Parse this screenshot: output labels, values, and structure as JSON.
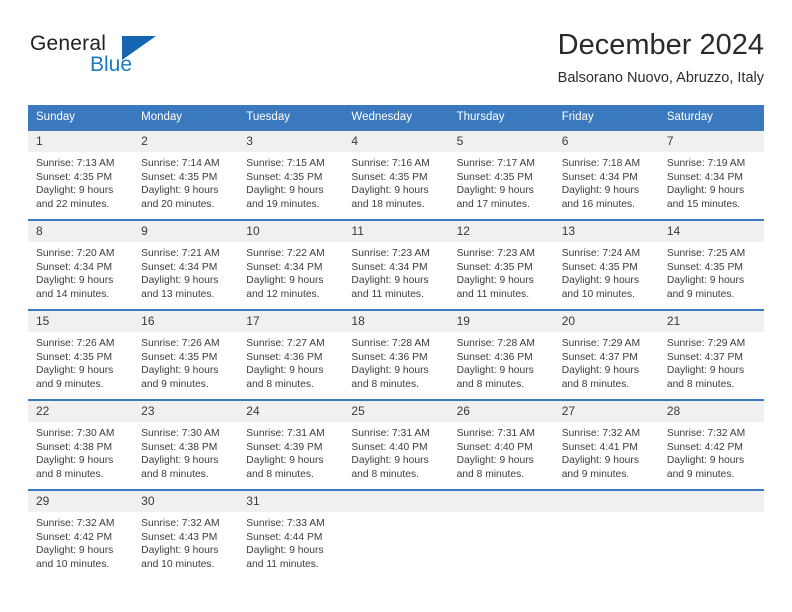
{
  "brand": {
    "name_top": "General",
    "name_bottom": "Blue"
  },
  "header": {
    "title": "December 2024",
    "subtitle": "Balsorano Nuovo, Abruzzo, Italy"
  },
  "colors": {
    "header_blue": "#3b79bf",
    "logo_blue": "#1a7bc4",
    "daynum_bg": "#f0f0f0"
  },
  "calendar": {
    "weekdays": [
      "Sunday",
      "Monday",
      "Tuesday",
      "Wednesday",
      "Thursday",
      "Friday",
      "Saturday"
    ],
    "weeks": [
      [
        {
          "day": "1",
          "sunrise": "Sunrise: 7:13 AM",
          "sunset": "Sunset: 4:35 PM",
          "daylight1": "Daylight: 9 hours",
          "daylight2": "and 22 minutes."
        },
        {
          "day": "2",
          "sunrise": "Sunrise: 7:14 AM",
          "sunset": "Sunset: 4:35 PM",
          "daylight1": "Daylight: 9 hours",
          "daylight2": "and 20 minutes."
        },
        {
          "day": "3",
          "sunrise": "Sunrise: 7:15 AM",
          "sunset": "Sunset: 4:35 PM",
          "daylight1": "Daylight: 9 hours",
          "daylight2": "and 19 minutes."
        },
        {
          "day": "4",
          "sunrise": "Sunrise: 7:16 AM",
          "sunset": "Sunset: 4:35 PM",
          "daylight1": "Daylight: 9 hours",
          "daylight2": "and 18 minutes."
        },
        {
          "day": "5",
          "sunrise": "Sunrise: 7:17 AM",
          "sunset": "Sunset: 4:35 PM",
          "daylight1": "Daylight: 9 hours",
          "daylight2": "and 17 minutes."
        },
        {
          "day": "6",
          "sunrise": "Sunrise: 7:18 AM",
          "sunset": "Sunset: 4:34 PM",
          "daylight1": "Daylight: 9 hours",
          "daylight2": "and 16 minutes."
        },
        {
          "day": "7",
          "sunrise": "Sunrise: 7:19 AM",
          "sunset": "Sunset: 4:34 PM",
          "daylight1": "Daylight: 9 hours",
          "daylight2": "and 15 minutes."
        }
      ],
      [
        {
          "day": "8",
          "sunrise": "Sunrise: 7:20 AM",
          "sunset": "Sunset: 4:34 PM",
          "daylight1": "Daylight: 9 hours",
          "daylight2": "and 14 minutes."
        },
        {
          "day": "9",
          "sunrise": "Sunrise: 7:21 AM",
          "sunset": "Sunset: 4:34 PM",
          "daylight1": "Daylight: 9 hours",
          "daylight2": "and 13 minutes."
        },
        {
          "day": "10",
          "sunrise": "Sunrise: 7:22 AM",
          "sunset": "Sunset: 4:34 PM",
          "daylight1": "Daylight: 9 hours",
          "daylight2": "and 12 minutes."
        },
        {
          "day": "11",
          "sunrise": "Sunrise: 7:23 AM",
          "sunset": "Sunset: 4:34 PM",
          "daylight1": "Daylight: 9 hours",
          "daylight2": "and 11 minutes."
        },
        {
          "day": "12",
          "sunrise": "Sunrise: 7:23 AM",
          "sunset": "Sunset: 4:35 PM",
          "daylight1": "Daylight: 9 hours",
          "daylight2": "and 11 minutes."
        },
        {
          "day": "13",
          "sunrise": "Sunrise: 7:24 AM",
          "sunset": "Sunset: 4:35 PM",
          "daylight1": "Daylight: 9 hours",
          "daylight2": "and 10 minutes."
        },
        {
          "day": "14",
          "sunrise": "Sunrise: 7:25 AM",
          "sunset": "Sunset: 4:35 PM",
          "daylight1": "Daylight: 9 hours",
          "daylight2": "and 9 minutes."
        }
      ],
      [
        {
          "day": "15",
          "sunrise": "Sunrise: 7:26 AM",
          "sunset": "Sunset: 4:35 PM",
          "daylight1": "Daylight: 9 hours",
          "daylight2": "and 9 minutes."
        },
        {
          "day": "16",
          "sunrise": "Sunrise: 7:26 AM",
          "sunset": "Sunset: 4:35 PM",
          "daylight1": "Daylight: 9 hours",
          "daylight2": "and 9 minutes."
        },
        {
          "day": "17",
          "sunrise": "Sunrise: 7:27 AM",
          "sunset": "Sunset: 4:36 PM",
          "daylight1": "Daylight: 9 hours",
          "daylight2": "and 8 minutes."
        },
        {
          "day": "18",
          "sunrise": "Sunrise: 7:28 AM",
          "sunset": "Sunset: 4:36 PM",
          "daylight1": "Daylight: 9 hours",
          "daylight2": "and 8 minutes."
        },
        {
          "day": "19",
          "sunrise": "Sunrise: 7:28 AM",
          "sunset": "Sunset: 4:36 PM",
          "daylight1": "Daylight: 9 hours",
          "daylight2": "and 8 minutes."
        },
        {
          "day": "20",
          "sunrise": "Sunrise: 7:29 AM",
          "sunset": "Sunset: 4:37 PM",
          "daylight1": "Daylight: 9 hours",
          "daylight2": "and 8 minutes."
        },
        {
          "day": "21",
          "sunrise": "Sunrise: 7:29 AM",
          "sunset": "Sunset: 4:37 PM",
          "daylight1": "Daylight: 9 hours",
          "daylight2": "and 8 minutes."
        }
      ],
      [
        {
          "day": "22",
          "sunrise": "Sunrise: 7:30 AM",
          "sunset": "Sunset: 4:38 PM",
          "daylight1": "Daylight: 9 hours",
          "daylight2": "and 8 minutes."
        },
        {
          "day": "23",
          "sunrise": "Sunrise: 7:30 AM",
          "sunset": "Sunset: 4:38 PM",
          "daylight1": "Daylight: 9 hours",
          "daylight2": "and 8 minutes."
        },
        {
          "day": "24",
          "sunrise": "Sunrise: 7:31 AM",
          "sunset": "Sunset: 4:39 PM",
          "daylight1": "Daylight: 9 hours",
          "daylight2": "and 8 minutes."
        },
        {
          "day": "25",
          "sunrise": "Sunrise: 7:31 AM",
          "sunset": "Sunset: 4:40 PM",
          "daylight1": "Daylight: 9 hours",
          "daylight2": "and 8 minutes."
        },
        {
          "day": "26",
          "sunrise": "Sunrise: 7:31 AM",
          "sunset": "Sunset: 4:40 PM",
          "daylight1": "Daylight: 9 hours",
          "daylight2": "and 8 minutes."
        },
        {
          "day": "27",
          "sunrise": "Sunrise: 7:32 AM",
          "sunset": "Sunset: 4:41 PM",
          "daylight1": "Daylight: 9 hours",
          "daylight2": "and 9 minutes."
        },
        {
          "day": "28",
          "sunrise": "Sunrise: 7:32 AM",
          "sunset": "Sunset: 4:42 PM",
          "daylight1": "Daylight: 9 hours",
          "daylight2": "and 9 minutes."
        }
      ],
      [
        {
          "day": "29",
          "sunrise": "Sunrise: 7:32 AM",
          "sunset": "Sunset: 4:42 PM",
          "daylight1": "Daylight: 9 hours",
          "daylight2": "and 10 minutes."
        },
        {
          "day": "30",
          "sunrise": "Sunrise: 7:32 AM",
          "sunset": "Sunset: 4:43 PM",
          "daylight1": "Daylight: 9 hours",
          "daylight2": "and 10 minutes."
        },
        {
          "day": "31",
          "sunrise": "Sunrise: 7:33 AM",
          "sunset": "Sunset: 4:44 PM",
          "daylight1": "Daylight: 9 hours",
          "daylight2": "and 11 minutes."
        },
        {
          "day": "",
          "sunrise": "",
          "sunset": "",
          "daylight1": "",
          "daylight2": ""
        },
        {
          "day": "",
          "sunrise": "",
          "sunset": "",
          "daylight1": "",
          "daylight2": ""
        },
        {
          "day": "",
          "sunrise": "",
          "sunset": "",
          "daylight1": "",
          "daylight2": ""
        },
        {
          "day": "",
          "sunrise": "",
          "sunset": "",
          "daylight1": "",
          "daylight2": ""
        }
      ]
    ]
  }
}
